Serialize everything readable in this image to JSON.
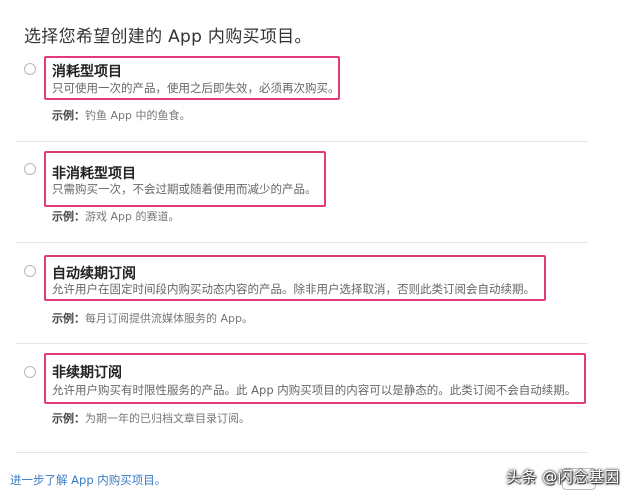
{
  "heading": "选择您希望创建的 App 内购买项目。",
  "example_label": "示例：",
  "options": [
    {
      "title": "消耗型项目",
      "description": "只可使用一次的产品，使用之后即失效，必须再次购买。",
      "example": "钓鱼 App 中的鱼食。",
      "selected": false
    },
    {
      "title": "非消耗型项目",
      "description": "只需购买一次，不会过期或随着使用而减少的产品。",
      "example": "游戏 App 的赛道。",
      "selected": false
    },
    {
      "title": "自动续期订阅",
      "description": "允许用户在固定时间段内购买动态内容的产品。除非用户选择取消，否则此类订阅会自动续期。",
      "example": "每月订阅提供流媒体服务的 App。",
      "selected": false
    },
    {
      "title": "非续期订阅",
      "description": "允许用户购买有时限性服务的产品。此 App 内购买项目的内容可以是静态的。此类订阅不会自动续期。",
      "example": "为期一年的已归档文章目录订阅。",
      "selected": false
    }
  ],
  "footer": {
    "learn_more": "进一步了解 App 内购买项目。",
    "watermark": "头条 @闪念基因"
  },
  "colors": {
    "highlight": "#e03b7a",
    "link": "#3b7cc4"
  }
}
